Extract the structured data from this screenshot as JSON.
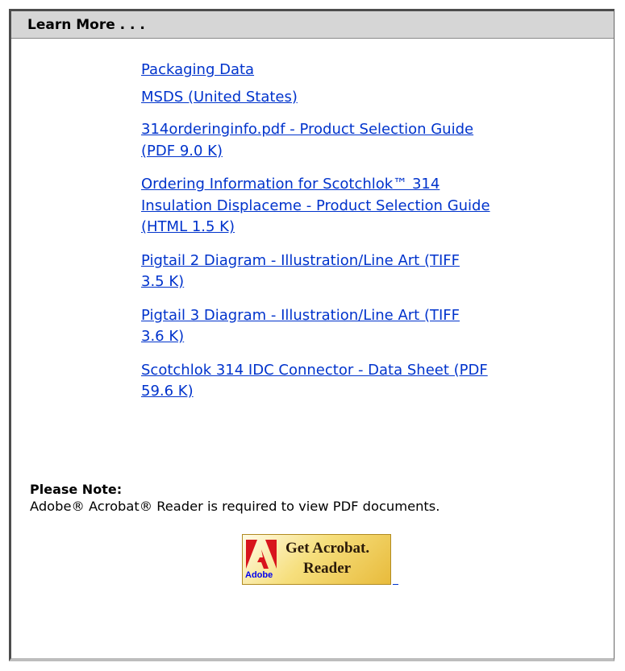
{
  "panel": {
    "title": "Learn More . . ."
  },
  "links": [
    [
      "Packaging Data"
    ],
    [
      "MSDS (United States)"
    ],
    [
      "314orderinginfo.pdf - Product Selection Guide ",
      "(PDF 9.0 K)"
    ],
    [
      "Ordering Information for Scotchlok™ 314 ",
      "Insulation Displaceme - Product Selection Guide ",
      "(HTML 1.5 K)"
    ],
    [
      "Pigtail 2 Diagram - Illustration/Line Art (TIFF ",
      "3.5 K)"
    ],
    [
      "Pigtail 3 Diagram - Illustration/Line Art (TIFF ",
      "3.6 K)"
    ],
    [
      "Scotchlok 314 IDC Connector - Data Sheet (PDF ",
      "59.6 K)"
    ]
  ],
  "note": {
    "title": "Please Note:",
    "text": "Adobe® Acrobat® Reader is required to view PDF documents."
  },
  "acrobat_badge": {
    "line1": "Get Acrobat.",
    "line2": "Reader",
    "brand": "Adobe",
    "colors": {
      "logo_red": "#d8141c",
      "gold": "#f0c845"
    }
  },
  "colors": {
    "link": "#0033cc",
    "header_bg": "#d6d6d6"
  }
}
